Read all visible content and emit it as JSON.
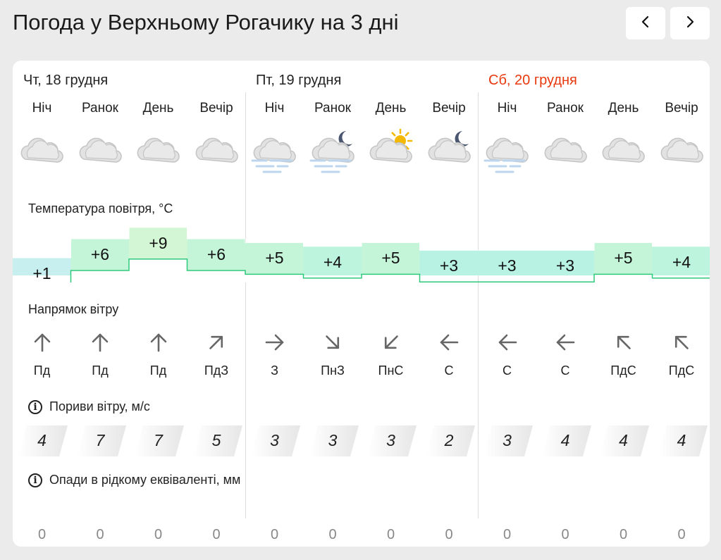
{
  "page": {
    "title": "Погода у Верхньому Рогачику на 3 дні"
  },
  "nav": {
    "prev_icon": "chevron-left-icon",
    "next_icon": "chevron-right-icon"
  },
  "days": [
    {
      "label": "Чт, 18 грудня",
      "weekend": false
    },
    {
      "label": "Пт, 19 грудня",
      "weekend": false
    },
    {
      "label": "Сб, 20 грудня",
      "weekend": true
    }
  ],
  "weekend_color": "#e8380d",
  "periods": [
    "Ніч",
    "Ранок",
    "День",
    "Вечір",
    "Ніч",
    "Ранок",
    "День",
    "Вечір",
    "Ніч",
    "Ранок",
    "День",
    "Вечір"
  ],
  "icons": [
    "cloudy-icon",
    "cloudy-icon",
    "cloudy-icon",
    "cloudy-icon",
    "cloudy-fog-icon",
    "cloudy-moon-fog-icon",
    "partly-sunny-icon",
    "cloudy-moon-icon",
    "cloudy-fog-icon",
    "cloudy-icon",
    "cloudy-icon",
    "cloudy-icon"
  ],
  "sections": {
    "temperature": "Температура повітря, °С",
    "wind_direction": "Напрямок вітру",
    "wind_gusts": "Пориви вітру, м/с",
    "precipitation": "Опади в рідкому еквіваленті, мм"
  },
  "temperatures": [
    "+1",
    "+6",
    "+9",
    "+6",
    "+5",
    "+4",
    "+5",
    "+3",
    "+3",
    "+3",
    "+5",
    "+4"
  ],
  "temperature_values": [
    1,
    6,
    9,
    6,
    5,
    4,
    5,
    3,
    3,
    3,
    5,
    4
  ],
  "wind": [
    {
      "label": "Пд",
      "icon": "arrow-up-icon",
      "angle": 0
    },
    {
      "label": "Пд",
      "icon": "arrow-up-icon",
      "angle": 0
    },
    {
      "label": "Пд",
      "icon": "arrow-up-icon",
      "angle": 0
    },
    {
      "label": "ПдЗ",
      "icon": "arrow-up-right-icon",
      "angle": 45
    },
    {
      "label": "З",
      "icon": "arrow-right-icon",
      "angle": 90
    },
    {
      "label": "ПнЗ",
      "icon": "arrow-down-right-icon",
      "angle": 135
    },
    {
      "label": "ПнС",
      "icon": "arrow-down-left-icon",
      "angle": 225
    },
    {
      "label": "С",
      "icon": "arrow-left-icon",
      "angle": 270
    },
    {
      "label": "С",
      "icon": "arrow-left-icon",
      "angle": 270
    },
    {
      "label": "С",
      "icon": "arrow-left-icon",
      "angle": 270
    },
    {
      "label": "ПдС",
      "icon": "arrow-up-left-icon",
      "angle": 315
    },
    {
      "label": "ПдС",
      "icon": "arrow-up-left-icon",
      "angle": 315
    }
  ],
  "gusts": [
    "4",
    "7",
    "7",
    "5",
    "3",
    "3",
    "3",
    "2",
    "3",
    "4",
    "4",
    "4"
  ],
  "precipitation": [
    "0",
    "0",
    "0",
    "0",
    "0",
    "0",
    "0",
    "0",
    "0",
    "0",
    "0",
    "0"
  ]
}
